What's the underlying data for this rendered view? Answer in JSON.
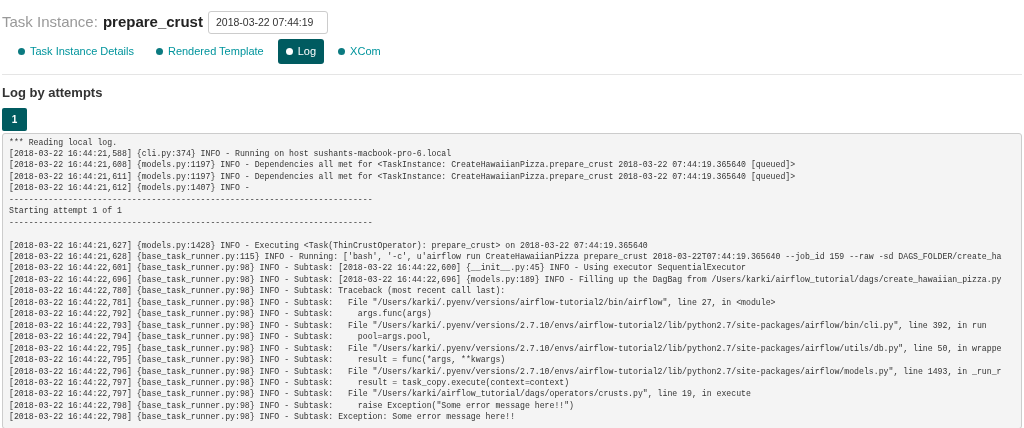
{
  "header": {
    "label": "Task Instance:",
    "task": "prepare_crust",
    "execution_date": "2018-03-22 07:44:19"
  },
  "tabs": [
    {
      "label": "Task Instance Details",
      "selected": false
    },
    {
      "label": "Rendered Template",
      "selected": false
    },
    {
      "label": "Log",
      "selected": true
    },
    {
      "label": "XCom",
      "selected": false
    }
  ],
  "section_title": "Log by attempts",
  "attempts": [
    {
      "label": "1",
      "selected": true
    }
  ],
  "log_text": "*** Reading local log.\n[2018-03-22 16:44:21,588] {cli.py:374} INFO - Running on host sushants-macbook-pro-6.local\n[2018-03-22 16:44:21,608] {models.py:1197} INFO - Dependencies all met for <TaskInstance: CreateHawaiianPizza.prepare_crust 2018-03-22 07:44:19.365640 [queued]>\n[2018-03-22 16:44:21,611] {models.py:1197} INFO - Dependencies all met for <TaskInstance: CreateHawaiianPizza.prepare_crust 2018-03-22 07:44:19.365640 [queued]>\n[2018-03-22 16:44:21,612] {models.py:1407} INFO - \n--------------------------------------------------------------------------\nStarting attempt 1 of 1\n--------------------------------------------------------------------------\n\n[2018-03-22 16:44:21,627] {models.py:1428} INFO - Executing <Task(ThinCrustOperator): prepare_crust> on 2018-03-22 07:44:19.365640\n[2018-03-22 16:44:21,628] {base_task_runner.py:115} INFO - Running: ['bash', '-c', u'airflow run CreateHawaiianPizza prepare_crust 2018-03-22T07:44:19.365640 --job_id 159 --raw -sd DAGS_FOLDER/create_ha\n[2018-03-22 16:44:22,601] {base_task_runner.py:98} INFO - Subtask: [2018-03-22 16:44:22,600] {__init__.py:45} INFO - Using executor SequentialExecutor\n[2018-03-22 16:44:22,696] {base_task_runner.py:98} INFO - Subtask: [2018-03-22 16:44:22,696] {models.py:189} INFO - Filling up the DagBag from /Users/karki/airflow_tutorial/dags/create_hawaiian_pizza.py\n[2018-03-22 16:44:22,780] {base_task_runner.py:98} INFO - Subtask: Traceback (most recent call last):\n[2018-03-22 16:44:22,781] {base_task_runner.py:98} INFO - Subtask:   File \"/Users/karki/.pyenv/versions/airflow-tutorial2/bin/airflow\", line 27, in <module>\n[2018-03-22 16:44:22,792] {base_task_runner.py:98} INFO - Subtask:     args.func(args)\n[2018-03-22 16:44:22,793] {base_task_runner.py:98} INFO - Subtask:   File \"/Users/karki/.pyenv/versions/2.7.10/envs/airflow-tutorial2/lib/python2.7/site-packages/airflow/bin/cli.py\", line 392, in run\n[2018-03-22 16:44:22,794] {base_task_runner.py:98} INFO - Subtask:     pool=args.pool,\n[2018-03-22 16:44:22,795] {base_task_runner.py:98} INFO - Subtask:   File \"/Users/karki/.pyenv/versions/2.7.10/envs/airflow-tutorial2/lib/python2.7/site-packages/airflow/utils/db.py\", line 50, in wrappe\n[2018-03-22 16:44:22,795] {base_task_runner.py:98} INFO - Subtask:     result = func(*args, **kwargs)\n[2018-03-22 16:44:22,796] {base_task_runner.py:98} INFO - Subtask:   File \"/Users/karki/.pyenv/versions/2.7.10/envs/airflow-tutorial2/lib/python2.7/site-packages/airflow/models.py\", line 1493, in _run_r\n[2018-03-22 16:44:22,797] {base_task_runner.py:98} INFO - Subtask:     result = task_copy.execute(context=context)\n[2018-03-22 16:44:22,797] {base_task_runner.py:98} INFO - Subtask:   File \"/Users/karki/airflow_tutorial/dags/operators/crusts.py\", line 19, in execute\n[2018-03-22 16:44:22,798] {base_task_runner.py:98} INFO - Subtask:     raise Exception(\"Some error message here!!\")\n[2018-03-22 16:44:22,798] {base_task_runner.py:98} INFO - Subtask: Exception: Some error message here!!"
}
